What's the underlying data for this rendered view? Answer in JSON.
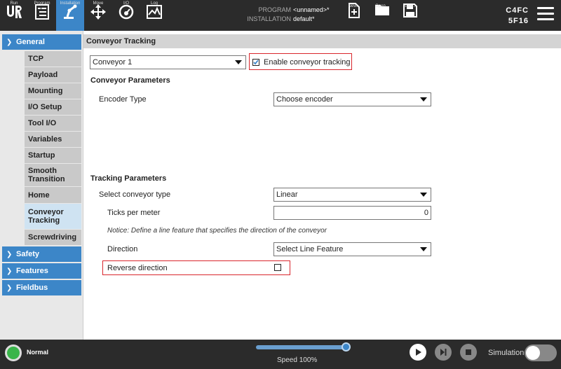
{
  "topbar": {
    "buttons": [
      {
        "label": "Run",
        "icon": "ur-logo-icon"
      },
      {
        "label": "Program",
        "icon": "program-icon"
      },
      {
        "label": "Installation",
        "icon": "robot-arm-icon"
      },
      {
        "label": "Move",
        "icon": "move-arrows-icon"
      },
      {
        "label": "I/O",
        "icon": "io-gauge-icon"
      },
      {
        "label": "Log",
        "icon": "log-chart-icon"
      }
    ],
    "program_label": "PROGRAM",
    "installation_label": "INSTALLATION",
    "program_value": "<unnamed>*",
    "installation_value": "default*",
    "file_buttons": [
      {
        "label": "New...",
        "icon": "new-file-icon"
      },
      {
        "label": "Open...",
        "icon": "folder-icon"
      },
      {
        "label": "Save...",
        "icon": "save-disk-icon"
      }
    ],
    "robot_id_line1": "C4FC",
    "robot_id_line2": "5F16",
    "menu_icon": "hamburger-menu-icon"
  },
  "leftnav": {
    "general": "General",
    "items": [
      "TCP",
      "Payload",
      "Mounting",
      "I/O Setup",
      "Tool I/O",
      "Variables",
      "Startup",
      "Smooth Transition",
      "Home",
      "Conveyor Tracking",
      "Screwdriving"
    ],
    "selected": "Conveyor Tracking",
    "groups": [
      "Safety",
      "Features",
      "Fieldbus"
    ]
  },
  "main": {
    "title": "Conveyor Tracking",
    "conveyor_select": "Conveyor 1",
    "enable_label": "Enable conveyor tracking",
    "enable_checked": true,
    "conveyor_params_title": "Conveyor Parameters",
    "encoder_type_label": "Encoder Type",
    "encoder_type_value": "Choose encoder",
    "tracking_params_title": "Tracking Parameters",
    "conveyor_type_label": "Select conveyor type",
    "conveyor_type_value": "Linear",
    "ticks_label": "Ticks per meter",
    "ticks_value": "0",
    "notice": "Notice: Define a line feature that specifies the direction of the conveyor",
    "direction_label": "Direction",
    "direction_value": "Select Line Feature",
    "reverse_label": "Reverse direction",
    "reverse_checked": false
  },
  "bottombar": {
    "status": "Normal",
    "status_color": "#39b54a",
    "speed_label": "Speed 100%",
    "speed_fraction": 1.0,
    "simulation_label": "Simulation",
    "simulation_on": false
  },
  "colors": {
    "accent": "#3c86c8",
    "highlight_box": "#d9262c"
  }
}
